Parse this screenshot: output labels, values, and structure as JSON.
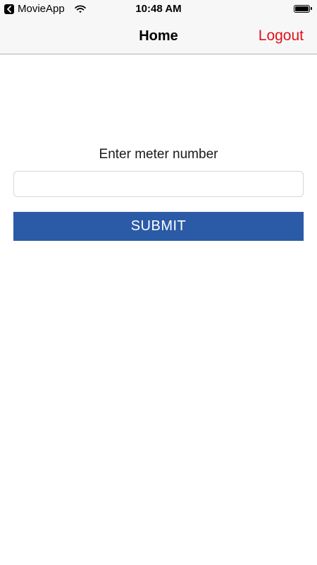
{
  "status_bar": {
    "back_app_label": "MovieApp",
    "time": "10:48 AM",
    "icons": [
      "back-chevron-icon",
      "wifi-icon",
      "battery-icon"
    ],
    "battery_level": 1.0
  },
  "nav": {
    "title": "Home",
    "logout_label": "Logout",
    "logout_color": "#e3101b"
  },
  "form": {
    "label": "Enter meter number",
    "meter_input_value": "",
    "meter_input_placeholder": "",
    "submit_label": "SUBMIT",
    "submit_color": "#2b5ba7"
  }
}
